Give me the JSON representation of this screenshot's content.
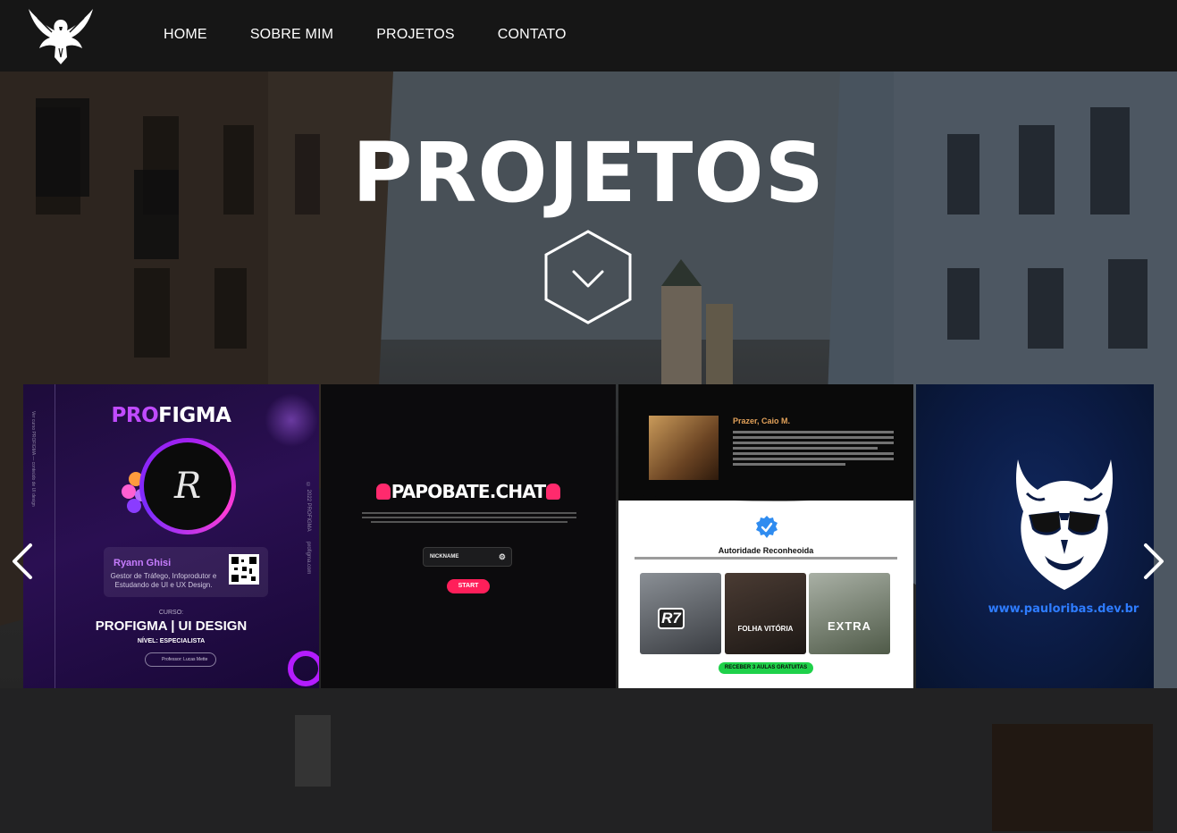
{
  "nav": {
    "logo_alt": "phoenix-logo",
    "items": [
      "HOME",
      "SOBRE MIM",
      "PROJETOS",
      "CONTATO"
    ]
  },
  "hero": {
    "title": "PROJETOS",
    "scroll_icon": "chevron-down-icon"
  },
  "carousel": {
    "prev_icon": "chevron-left-icon",
    "next_icon": "chevron-right-icon",
    "slides": [
      {
        "logo_pro": "PRO",
        "logo_rest": "FIGMA",
        "name": "Ryann Ghisi",
        "desc": "Gestor de Tráfego, Infoprodutor e Estudando de UI e UX Design.",
        "curso_label": "CURSO:",
        "title": "PROFIGMA | UI DESIGN",
        "level": "NÍVEL: ESPECIALISTA",
        "professor": "Professor: Lucas Mette",
        "side_text": "© 2022 PROFIGMA",
        "side_url": "profigma.com",
        "monogram": "R"
      },
      {
        "logo": "PAPOBATE.CHAT",
        "input_placeholder": "NICKNAME",
        "button": "START"
      },
      {
        "greeting": "Prazer, Caio M.",
        "section_title": "Autoridade Reconheoida",
        "media": [
          "R7",
          "FOLHA VITÓRIA",
          "EXTRA"
        ],
        "cta": "RECEBER 3 AULAS GRATUITAS"
      },
      {
        "url": "www.pauloribas.dev.br"
      }
    ]
  },
  "colors": {
    "nav_bg": "#161616",
    "profigma_accent": "#c04bff",
    "papobate_accent": "#ff1f5a",
    "caio_cta": "#1fd14a",
    "pauloribas_url": "#2e7cff"
  }
}
